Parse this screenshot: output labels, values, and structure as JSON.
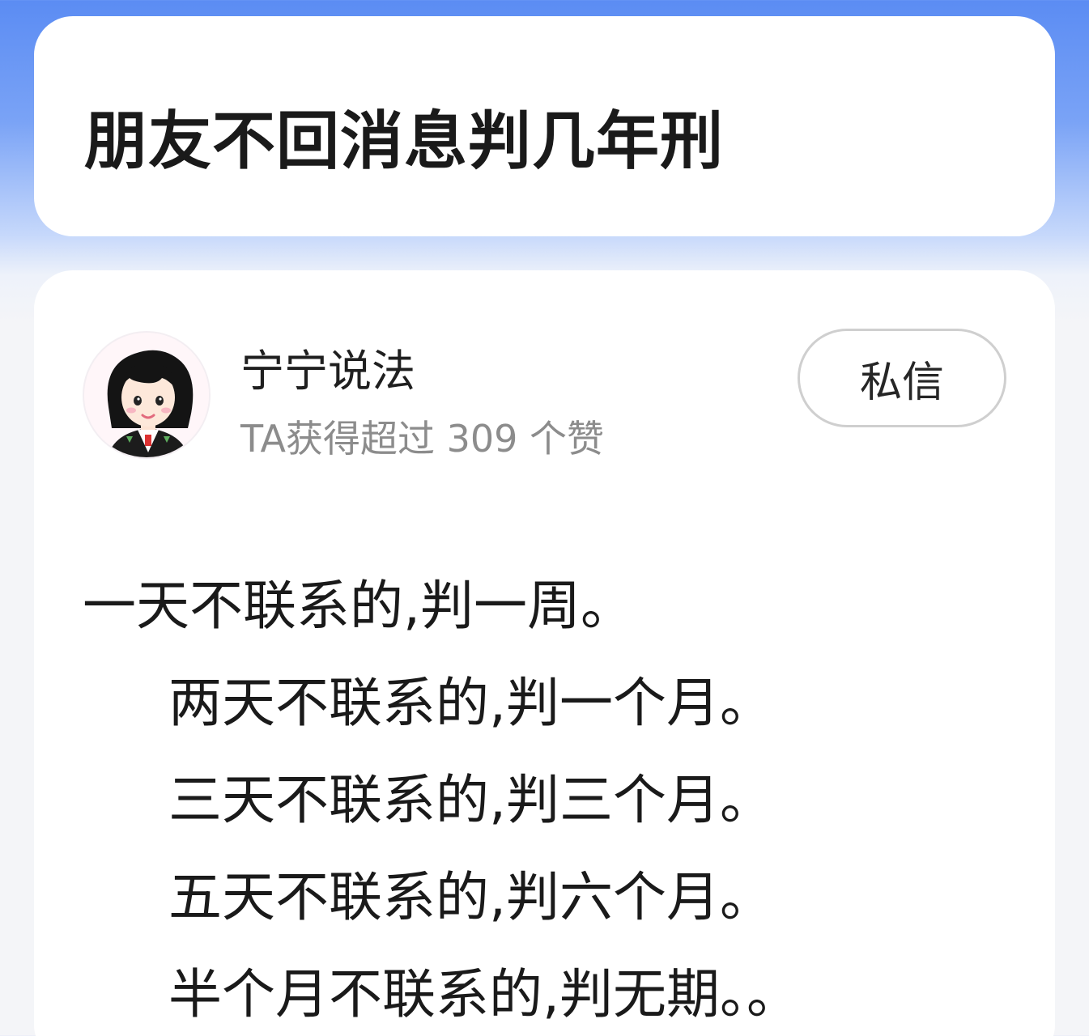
{
  "question": {
    "title": "朋友不回消息判几年刑"
  },
  "answer": {
    "author": {
      "name": "宁宁说法",
      "likes_text": "TA获得超过 309 个赞",
      "avatar_icon": "avatar-woman-lawyer-icon"
    },
    "message_button_label": "私信",
    "lines": [
      "一天不联系的,判一周。",
      "两天不联系的,判一个月。",
      "三天不联系的,判三个月。",
      "五天不联系的,判六个月。",
      "半个月不联系的,判无期。。"
    ]
  },
  "colors": {
    "header_blue": "#5b8cf3",
    "card_bg": "#ffffff",
    "text_primary": "#1a1a1a",
    "text_secondary": "#8c8c8c"
  }
}
